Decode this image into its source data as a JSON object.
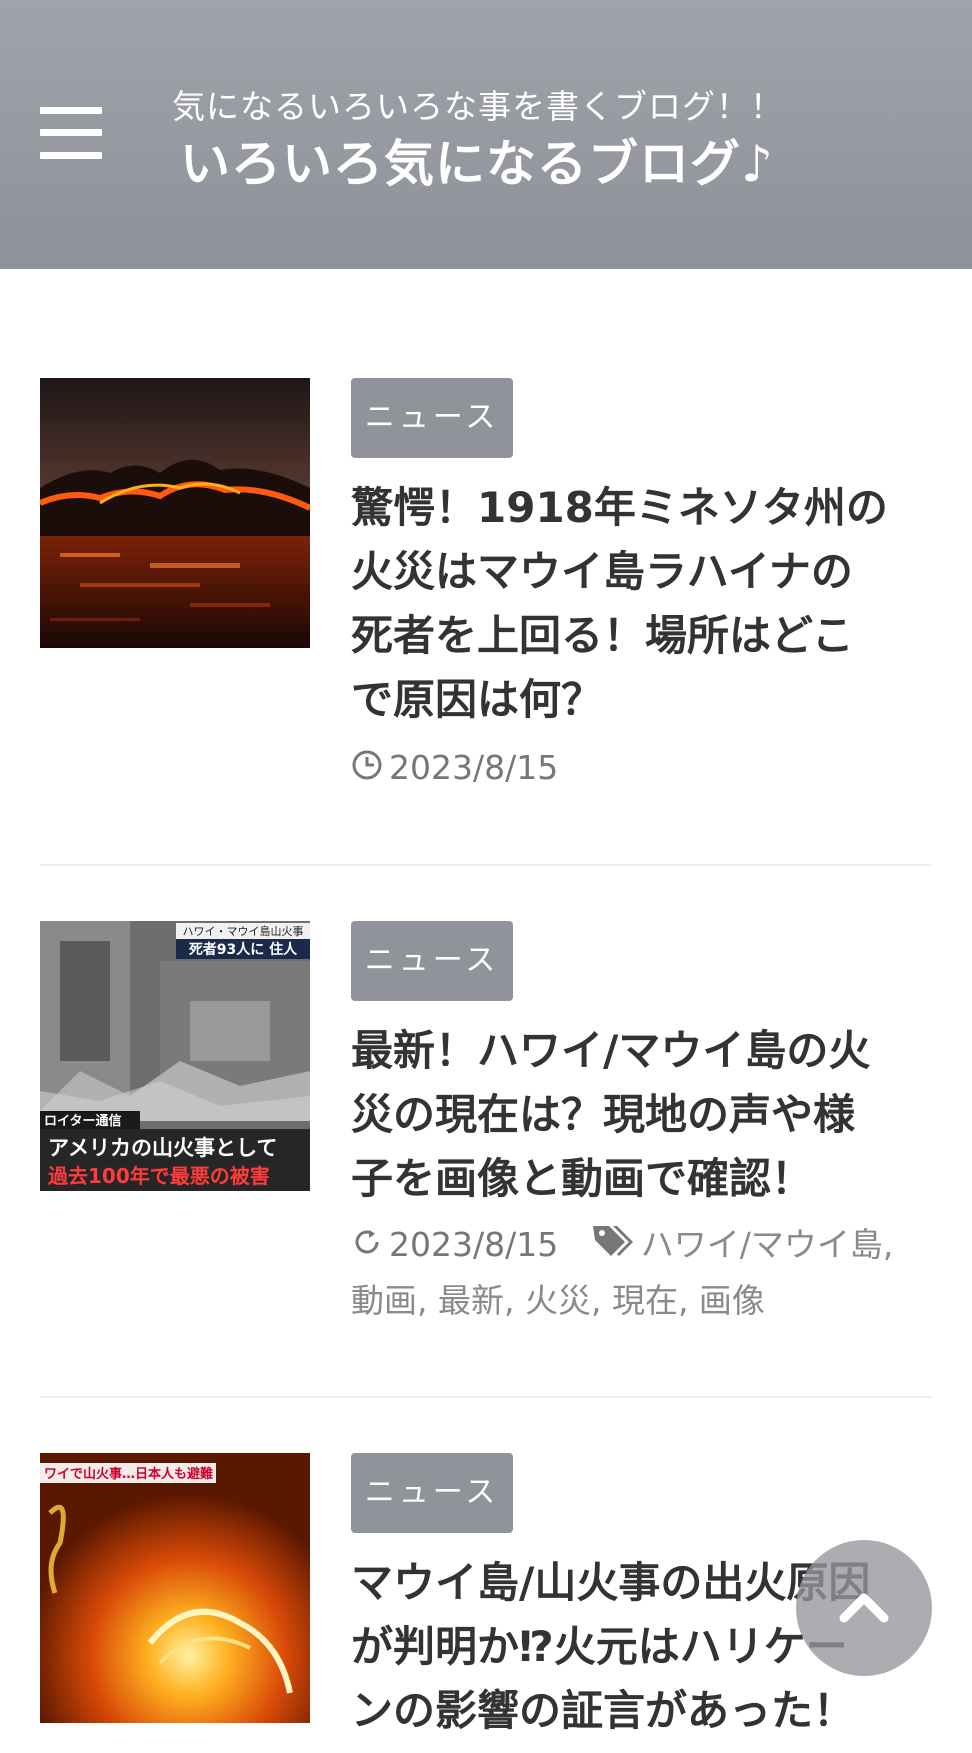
{
  "header": {
    "tagline": "気になるいろいろな事を書くブログ！！",
    "site_title": "いろいろ気になるブログ♪",
    "menu_icon": "hamburger-menu-icon"
  },
  "posts": [
    {
      "category": "ニュース",
      "title_lines": [
        "驚愕！1918年ミネソタ州の",
        "火災はマウイ島ラハイナの",
        "死者を上回る！場所はどこ",
        "で原因は何？"
      ],
      "date_icon": "clock-icon",
      "date": "2023/8/15"
    },
    {
      "category": "ニュース",
      "thumb_text": [
        "ハワイ・マウイ島山火事",
        "死者93人に 住人",
        "ロイター通信",
        "アメリカの山火事として",
        "過去100年で最悪の被害"
      ],
      "title_lines": [
        "最新！ハワイ/マウイ島の火",
        "災の現在は？現地の声や様",
        "子を画像と動画で確認！"
      ],
      "date_icon": "refresh-icon",
      "date": "2023/8/15",
      "tag_icon": "tag-icon",
      "tags_line1": "ハワイ/マウイ島,",
      "tags_line2": "動画, 最新, 火災, 現在, 画像"
    },
    {
      "category": "ニュース",
      "thumb_text": [
        "ワイで山火事…日本人も避難"
      ],
      "title_lines": [
        "マウイ島/山火事の出火原因",
        "が判明か⁉火元はハリケー",
        "ンの影響の証言があった！"
      ]
    }
  ],
  "scroll_top_icon": "chevron-up-icon",
  "colors": {
    "header": "#9a9da4",
    "category_badge": "#909399",
    "title_text": "#333333",
    "meta_text": "#777777"
  }
}
